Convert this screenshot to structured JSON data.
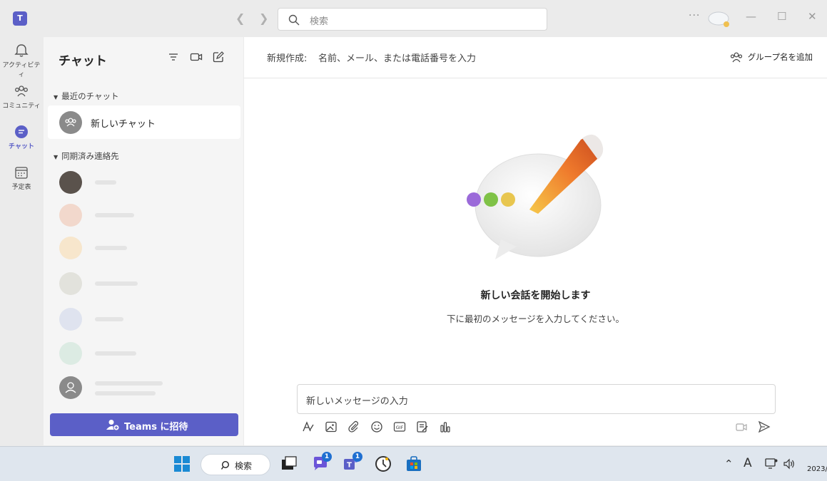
{
  "titlebar": {
    "app_logo": "T",
    "search_placeholder": "検索",
    "more": "···"
  },
  "rail": {
    "items": [
      {
        "label": "アクティビティ",
        "icon": "bell-icon"
      },
      {
        "label": "コミュニティ",
        "icon": "community-icon"
      },
      {
        "label": "チャット",
        "icon": "chat-icon"
      },
      {
        "label": "予定表",
        "icon": "calendar-icon"
      }
    ],
    "active": "チャット",
    "accent": "#5b5fc7"
  },
  "chat_pane": {
    "title": "チャット",
    "recent_label": "最近のチャット",
    "new_chat": "新しいチャット",
    "synced_label": "同期済み連絡先",
    "invite_button": "Teams に招待"
  },
  "main": {
    "to_label": "新規作成:",
    "to_placeholder": "名前、メール、または電話番号を入力",
    "add_group": "グループ名を追加",
    "empty_title": "新しい会話を開始します",
    "empty_subtitle": "下に最初のメッセージを入力してください。",
    "composer_placeholder": "新しいメッセージの入力"
  },
  "taskbar": {
    "search_label": "検索",
    "chat_badge": "1",
    "teams_badge": "1",
    "ime": "A",
    "date": "2023/"
  }
}
